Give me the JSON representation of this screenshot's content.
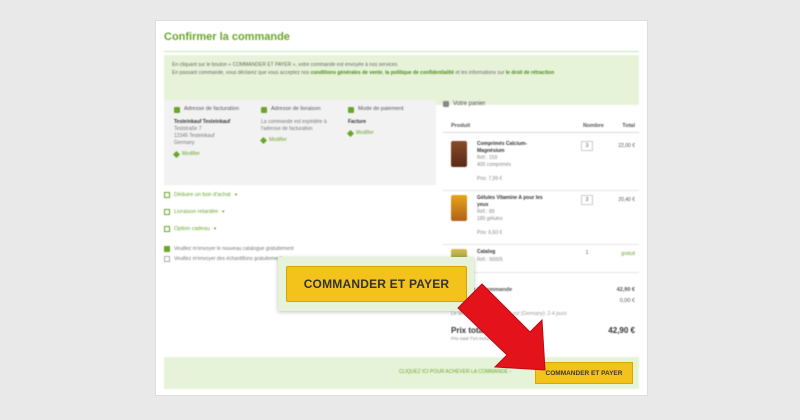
{
  "page": {
    "title": "Confirmer la commande"
  },
  "notice": {
    "line1": "En cliquant sur le bouton « COMMANDER ET PAYER », votre commande est envoyée à nos services.",
    "line2_pre": "En passant commande, vous déclarez que vous acceptez nos",
    "terms_link": "conditions générales de vente",
    "sep1": ",",
    "privacy_link": "la politique de confidentialité",
    "sep2": "et les informations sur",
    "withdrawal_link": "le droit de rétraction"
  },
  "addresses": {
    "billing": {
      "heading": "Adresse de facturation",
      "name": "Testeinkauf Testeinkauf",
      "street": "Teststraße 7",
      "city": "12345 Testeinkauf",
      "country": "Germany",
      "edit": "Modifier"
    },
    "shipping": {
      "heading": "Adresse de livraison",
      "text1": "La commande est expédiée à",
      "text2": "l'adresse de facturation",
      "edit": "Modifier"
    },
    "payment": {
      "heading": "Mode de paiement",
      "method": "Facture",
      "edit": "Modifier"
    }
  },
  "options": {
    "voucher": "Déduire un bon d'achat",
    "delivery": "Livraison retardée",
    "gift": "Option cadeau"
  },
  "checkboxes": {
    "catalog": "Veuillez m'envoyer le nouveau catalogue gratuitement",
    "samples": "Veuillez m'envoyer des échantillons gratuitement"
  },
  "cart": {
    "title": "Votre panier",
    "col_product": "Produit",
    "col_qty": "Nombre",
    "col_total": "Total",
    "items": [
      {
        "name": "Comprimés Calcium-Magnésium",
        "ref": "Réf.: 159",
        "size": "400 comprimés",
        "unit_price": "Prix: 7,99 €",
        "qty": "3",
        "price": "22,00 €"
      },
      {
        "name": "Gélules Vitamine A pour les yeux",
        "ref": "Réf.: 89",
        "size": "180 gélules",
        "unit_price": "Prix: 6,60 €",
        "qty": "3",
        "price": "20,40 €"
      },
      {
        "name": "Catalog",
        "ref": "Réf.: 90005",
        "qty": "1",
        "price": "gratuit"
      }
    ],
    "subtotal_label": "Valeur de la commande",
    "subtotal_value": "42,90 €",
    "shipping_value": "0,00 €",
    "delivery_note": "Le délai de livraison estimé est (Germany): 2-4 jours",
    "total_label": "Prix total",
    "total_sub": "Prix total TVA incluse",
    "total_value": "42,90 €"
  },
  "footer": {
    "hint": "CLIQUEZ ICI POUR ACHEVER LA COMMANDE",
    "button": "COMMANDER ET PAYER"
  },
  "callout": {
    "button": "COMMANDER ET PAYER"
  },
  "colors": {
    "accent_green": "#6aa52a",
    "light_green": "#e7f3d9",
    "button_yellow": "#f3c31b",
    "arrow_red": "#e3121b"
  }
}
